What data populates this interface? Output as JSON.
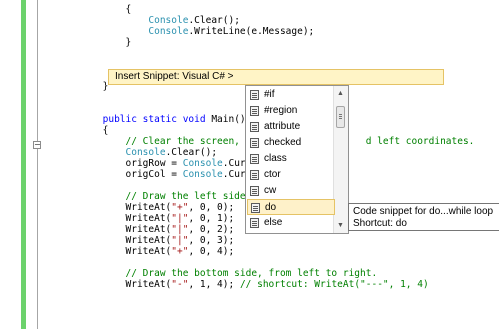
{
  "code_lines": [
    {
      "segments": [
        {
          "cls": "tx",
          "text": "                {"
        }
      ]
    },
    {
      "segments": [
        {
          "cls": "tx",
          "text": "                    "
        },
        {
          "cls": "tp",
          "text": "Console"
        },
        {
          "cls": "tx",
          "text": ".Clear();"
        }
      ]
    },
    {
      "segments": [
        {
          "cls": "tx",
          "text": "                    "
        },
        {
          "cls": "tp",
          "text": "Console"
        },
        {
          "cls": "tx",
          "text": ".WriteLine(e.Message);"
        }
      ]
    },
    {
      "segments": [
        {
          "cls": "tx",
          "text": "                }"
        }
      ]
    },
    {
      "segments": [
        {
          "cls": "tx",
          "text": ""
        }
      ]
    },
    {
      "segments": [
        {
          "cls": "tx",
          "text": ""
        }
      ]
    },
    {
      "segments": [
        {
          "cls": "tx",
          "text": ""
        }
      ]
    },
    {
      "segments": [
        {
          "cls": "tx",
          "text": "            }"
        }
      ]
    },
    {
      "segments": [
        {
          "cls": "tx",
          "text": ""
        }
      ]
    },
    {
      "segments": [
        {
          "cls": "tx",
          "text": ""
        }
      ]
    },
    {
      "segments": [
        {
          "cls": "kw",
          "text": "            public static void "
        },
        {
          "cls": "tx",
          "text": "Main()"
        }
      ]
    },
    {
      "segments": [
        {
          "cls": "tx",
          "text": "            {"
        }
      ]
    },
    {
      "segments": [
        {
          "cls": "cm",
          "text": "                // Clear the screen, th                   d left coordinates."
        }
      ]
    },
    {
      "segments": [
        {
          "cls": "tx",
          "text": "                "
        },
        {
          "cls": "tp",
          "text": "Console"
        },
        {
          "cls": "tx",
          "text": ".Clear();"
        }
      ]
    },
    {
      "segments": [
        {
          "cls": "tx",
          "text": "                origRow = "
        },
        {
          "cls": "tp",
          "text": "Console"
        },
        {
          "cls": "tx",
          "text": ".Curso"
        }
      ]
    },
    {
      "segments": [
        {
          "cls": "tx",
          "text": "                origCol = "
        },
        {
          "cls": "tp",
          "text": "Console"
        },
        {
          "cls": "tx",
          "text": ".Curso"
        }
      ]
    },
    {
      "segments": [
        {
          "cls": "tx",
          "text": ""
        }
      ]
    },
    {
      "segments": [
        {
          "cls": "cm",
          "text": "                // Draw the left side o"
        }
      ]
    },
    {
      "segments": [
        {
          "cls": "tx",
          "text": "                WriteAt("
        },
        {
          "cls": "str",
          "text": "\"+\""
        },
        {
          "cls": "tx",
          "text": ", 0, 0);"
        }
      ]
    },
    {
      "segments": [
        {
          "cls": "tx",
          "text": "                WriteAt("
        },
        {
          "cls": "str",
          "text": "\"|\""
        },
        {
          "cls": "tx",
          "text": ", 0, 1);"
        }
      ]
    },
    {
      "segments": [
        {
          "cls": "tx",
          "text": "                WriteAt("
        },
        {
          "cls": "str",
          "text": "\"|\""
        },
        {
          "cls": "tx",
          "text": ", 0, 2);"
        }
      ]
    },
    {
      "segments": [
        {
          "cls": "tx",
          "text": "                WriteAt("
        },
        {
          "cls": "str",
          "text": "\"|\""
        },
        {
          "cls": "tx",
          "text": ", 0, 3);"
        }
      ]
    },
    {
      "segments": [
        {
          "cls": "tx",
          "text": "                WriteAt("
        },
        {
          "cls": "str",
          "text": "\"+\""
        },
        {
          "cls": "tx",
          "text": ", 0, 4);"
        }
      ]
    },
    {
      "segments": [
        {
          "cls": "tx",
          "text": ""
        }
      ]
    },
    {
      "segments": [
        {
          "cls": "cm",
          "text": "                // Draw the bottom side, from left to right."
        }
      ]
    },
    {
      "segments": [
        {
          "cls": "tx",
          "text": "                WriteAt("
        },
        {
          "cls": "str",
          "text": "\"-\""
        },
        {
          "cls": "tx",
          "text": ", 1, 4); "
        },
        {
          "cls": "cm",
          "text": "// shortcut: WriteAt(\"---\", 1, 4)"
        }
      ]
    }
  ],
  "snippet_bar": {
    "text": "Insert Snippet:  Visual C#  >"
  },
  "completion": {
    "items": [
      {
        "label": "#if"
      },
      {
        "label": "#region"
      },
      {
        "label": "attribute"
      },
      {
        "label": "checked"
      },
      {
        "label": "class"
      },
      {
        "label": "ctor"
      },
      {
        "label": "cw"
      },
      {
        "label": "do",
        "selected": true
      },
      {
        "label": "else"
      }
    ],
    "scroll_up": "▲",
    "scroll_down": "▼"
  },
  "tooltip": {
    "line1": "Code snippet for do...while loop",
    "line2": "Shortcut: do"
  },
  "gutter": {
    "collapse_glyph": "−"
  },
  "colors": {
    "keyword": "#0000ff",
    "comment": "#008000",
    "type": "#2b91af",
    "string": "#a31515",
    "change_bar": "#6cd26c",
    "selection": "#fef1c9"
  }
}
